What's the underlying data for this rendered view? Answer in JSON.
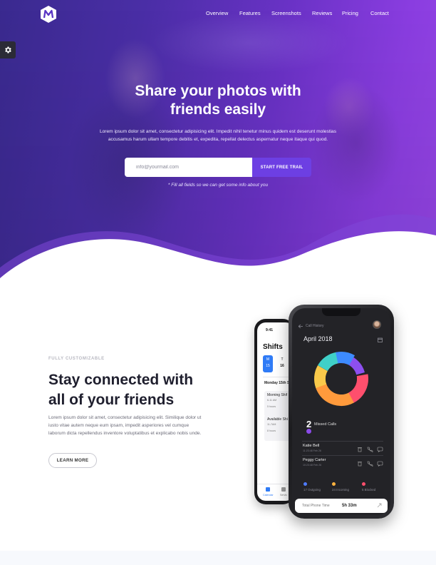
{
  "nav": {
    "items": [
      "Overview",
      "Features",
      "Screenshots",
      "Reviews",
      "Pricing",
      "Contact"
    ]
  },
  "hero": {
    "title_line1": "Share your photos with",
    "title_line2": "friends easily",
    "description": "Lorem ipsum dolor sit amet, consectetur adipisicing elit. Impedit nihil tenetur minus quidem est deserunt molestias accusamus harum ullam tempore debitis et, expedita, repellat delectus aspernatur neque itaque qui quod.",
    "email_placeholder": "info@yourmail.com",
    "cta_label": "START FREE TRAIL",
    "note": "* Fill all fields so we can get some info about you"
  },
  "feature": {
    "eyebrow": "FULLY CUSTOMIZABLE",
    "title_line1": "Stay connected with",
    "title_line2": "all of your friends",
    "description": "Lorem ipsum dolor sit amet, consectetur adipisicing elit. Similique dolor ut iusto vitae autem neque eum ipsam, impedit asperiores vel cumque laborum dicta repellendus inventore voluptatibus et explicabo nobis unde.",
    "button_label": "LEARN MORE"
  },
  "phone_back": {
    "time": "9:41",
    "title": "Shifts",
    "days": [
      {
        "letter": "M",
        "num": "15"
      },
      {
        "letter": "T",
        "num": "16"
      }
    ],
    "date_header": "Monday 15th S",
    "shifts": [
      {
        "title": "Morning Shif",
        "time": "6-11 AM",
        "hours": "5 hours"
      },
      {
        "title": "Available Shi",
        "time": "11-7AM",
        "hours": "8 hours"
      }
    ],
    "tab1": "Calendar",
    "tab2": "Servic"
  },
  "phone_front": {
    "header": "Call History",
    "month": "April 2018",
    "missed_count": "2",
    "missed_label": "Missed Calls",
    "contacts": [
      {
        "name": "Katie Bell",
        "detail": "11:23:48 Feb 26"
      },
      {
        "name": "Peggy Carter",
        "detail": "10:23:48 Feb 26"
      }
    ],
    "stats": [
      {
        "label": "17 Outgoing",
        "color": "#4f7cff"
      },
      {
        "label": "24 Incoming",
        "color": "#ffb23f"
      },
      {
        "label": "5 Blocked",
        "color": "#ff4f6d"
      }
    ],
    "total_label": "Total Phone Time",
    "total_value": "5h 33m"
  },
  "colors": {
    "hero_start": "#3a2a8f",
    "hero_end": "#9646e6",
    "accent": "#6d3fe3",
    "title_dark": "#1f1f2e"
  },
  "icons": [
    "logo-m-icon",
    "gear-icon",
    "back-arrow-icon",
    "calendar-icon",
    "trash-icon",
    "phone-icon",
    "chat-icon",
    "expand-icon"
  ]
}
